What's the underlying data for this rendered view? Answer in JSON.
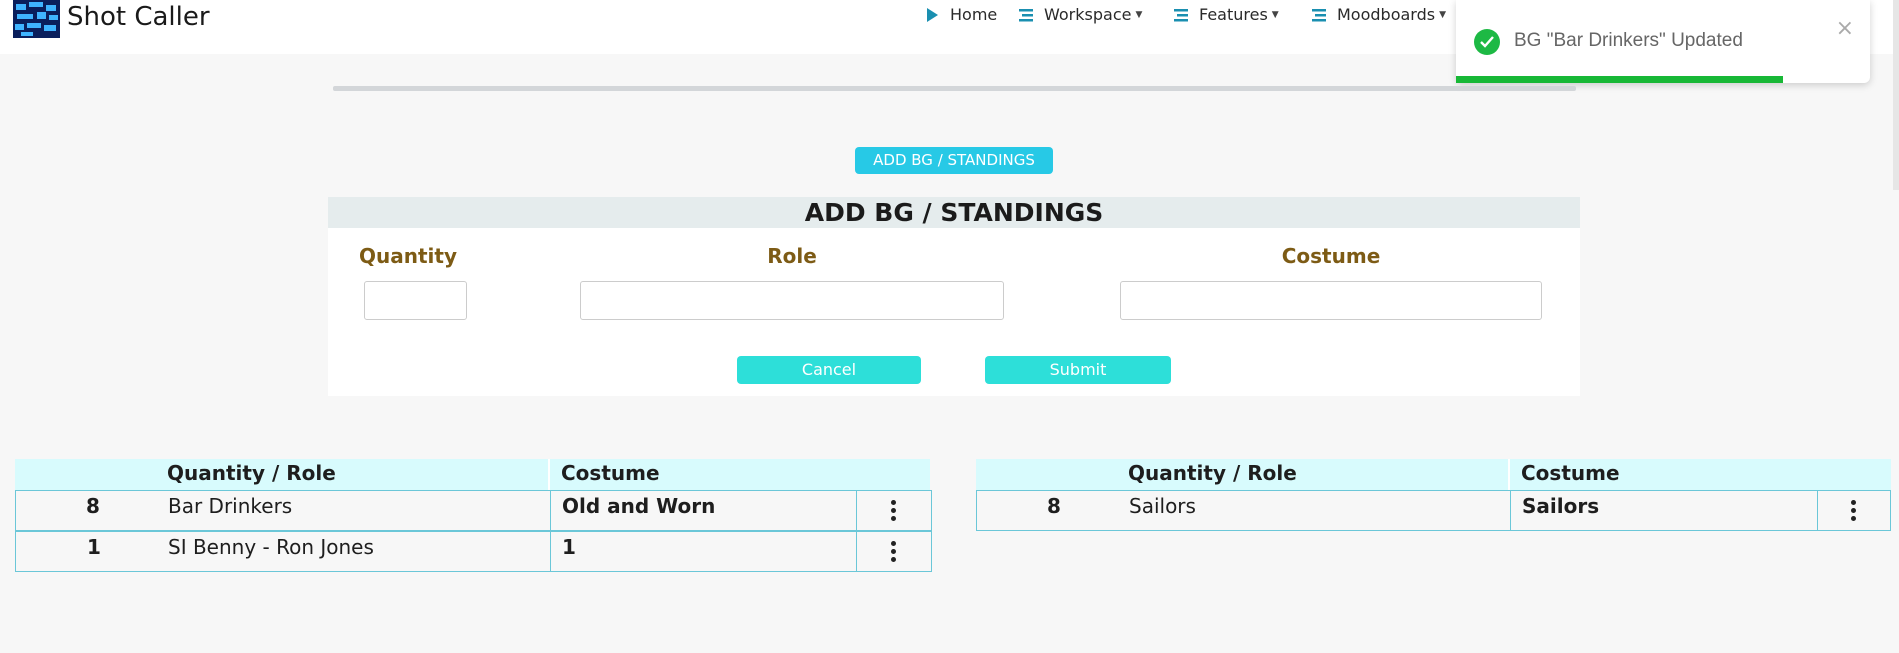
{
  "app": {
    "title": "Shot Caller"
  },
  "nav": [
    {
      "label": "Home",
      "icon": "play-icon"
    },
    {
      "label": "Workspace",
      "icon": "menu-icon"
    },
    {
      "label": "Features",
      "icon": "menu-icon"
    },
    {
      "label": "Moodboards",
      "icon": "menu-icon"
    }
  ],
  "toast": {
    "message": "BG \"Bar Drinkers\" Updated",
    "close": "×",
    "progress": 0.79,
    "color": "#18b836"
  },
  "actions": {
    "add_label": "ADD BG / STANDINGS"
  },
  "form": {
    "title": "ADD BG / STANDINGS",
    "quantity_label": "Quantity",
    "role_label": "Role",
    "costume_label": "Costume",
    "quantity_value": "",
    "role_value": "",
    "costume_value": "",
    "cancel_label": "Cancel",
    "submit_label": "Submit"
  },
  "tables": [
    {
      "headers": {
        "quantity_role": "Quantity / Role",
        "costume": "Costume"
      },
      "rows": [
        {
          "quantity": "8",
          "role": "Bar Drinkers",
          "costume": "Old and Worn"
        },
        {
          "quantity": "1",
          "role": "SI Benny - Ron Jones",
          "costume": "1"
        }
      ]
    },
    {
      "headers": {
        "quantity_role": "Quantity / Role",
        "costume": "Costume"
      },
      "rows": [
        {
          "quantity": "8",
          "role": "Sailors",
          "costume": "Sailors"
        }
      ]
    }
  ],
  "colors": {
    "accent": "#27c9e6",
    "form_button": "#2ddfd9",
    "label": "#7d5b15",
    "table_header": "#d8fbfd"
  }
}
